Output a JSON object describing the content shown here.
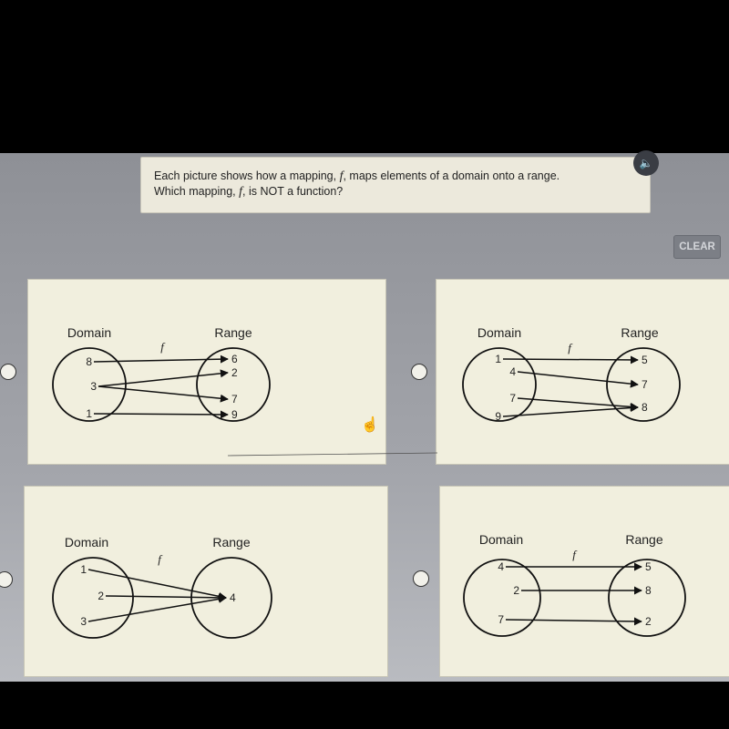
{
  "question": {
    "line1_before": "Each picture shows how a mapping, ",
    "line1_f": "f",
    "line1_after": ", maps elements of a domain onto a range.",
    "line2_before": "Which mapping, ",
    "line2_f": "f",
    "line2_after": ", is NOT a function?"
  },
  "audio_icon": "speaker-icon",
  "clear_label": "CLEAR",
  "options": [
    {
      "domain_label": "Domain",
      "range_label": "Range",
      "f_label": "f",
      "domain": [
        "8",
        "3",
        "1"
      ],
      "range": [
        "6",
        "2",
        "7",
        "9"
      ],
      "mappings": [
        [
          "8",
          "6"
        ],
        [
          "3",
          "2"
        ],
        [
          "3",
          "7"
        ],
        [
          "1",
          "9"
        ]
      ]
    },
    {
      "domain_label": "Domain",
      "range_label": "Range",
      "f_label": "f",
      "domain": [
        "1",
        "4",
        "7",
        "9"
      ],
      "range": [
        "5",
        "7",
        "8"
      ],
      "mappings": [
        [
          "1",
          "5"
        ],
        [
          "4",
          "7"
        ],
        [
          "7",
          "8"
        ],
        [
          "9",
          "8"
        ]
      ]
    },
    {
      "domain_label": "Domain",
      "range_label": "Range",
      "f_label": "f",
      "domain": [
        "1",
        "2",
        "3"
      ],
      "range": [
        "4"
      ],
      "mappings": [
        [
          "1",
          "4"
        ],
        [
          "2",
          "4"
        ],
        [
          "3",
          "4"
        ]
      ]
    },
    {
      "domain_label": "Domain",
      "range_label": "Range",
      "f_label": "f",
      "domain": [
        "4",
        "2",
        "7"
      ],
      "range": [
        "5",
        "8",
        "2"
      ],
      "mappings": [
        [
          "4",
          "5"
        ],
        [
          "2",
          "8"
        ],
        [
          "7",
          "2"
        ]
      ]
    }
  ]
}
